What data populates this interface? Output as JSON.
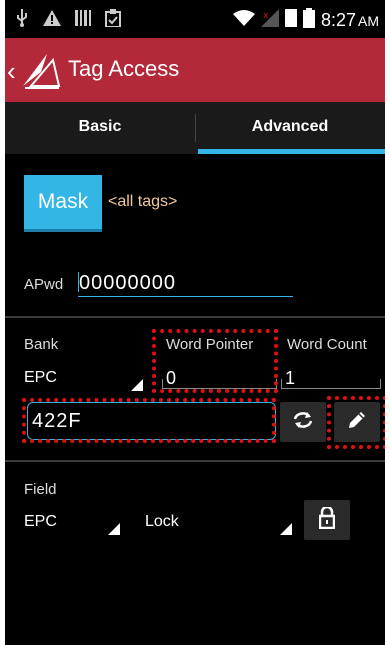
{
  "status_bar": {
    "time": "8:27",
    "ampm": "AM"
  },
  "header": {
    "title": "Tag Access",
    "back_glyph": "‹"
  },
  "tabs": [
    {
      "label": "Basic"
    },
    {
      "label": "Advanced"
    }
  ],
  "mask": {
    "button_label": "Mask",
    "filter_text": "<all tags>"
  },
  "access_password": {
    "label": "APwd",
    "value": "00000000"
  },
  "memory": {
    "bank_label": "Bank",
    "bank_value": "EPC",
    "word_pointer_label": "Word Pointer",
    "word_pointer_value": "0",
    "word_count_label": "Word Count",
    "word_count_value": "1",
    "data_value": "422F"
  },
  "field": {
    "label": "Field",
    "field_value": "EPC",
    "action_value": "Lock"
  },
  "colors": {
    "header": "#b3293a",
    "accent": "#33b5e5",
    "highlight": "#e01010"
  },
  "icons": [
    "usb-icon",
    "warning-icon",
    "barcode-icon",
    "clipboard-icon",
    "wifi-icon",
    "signal-icon",
    "battery-icon",
    "refresh-icon",
    "edit-pencil-icon",
    "lock-icon"
  ]
}
